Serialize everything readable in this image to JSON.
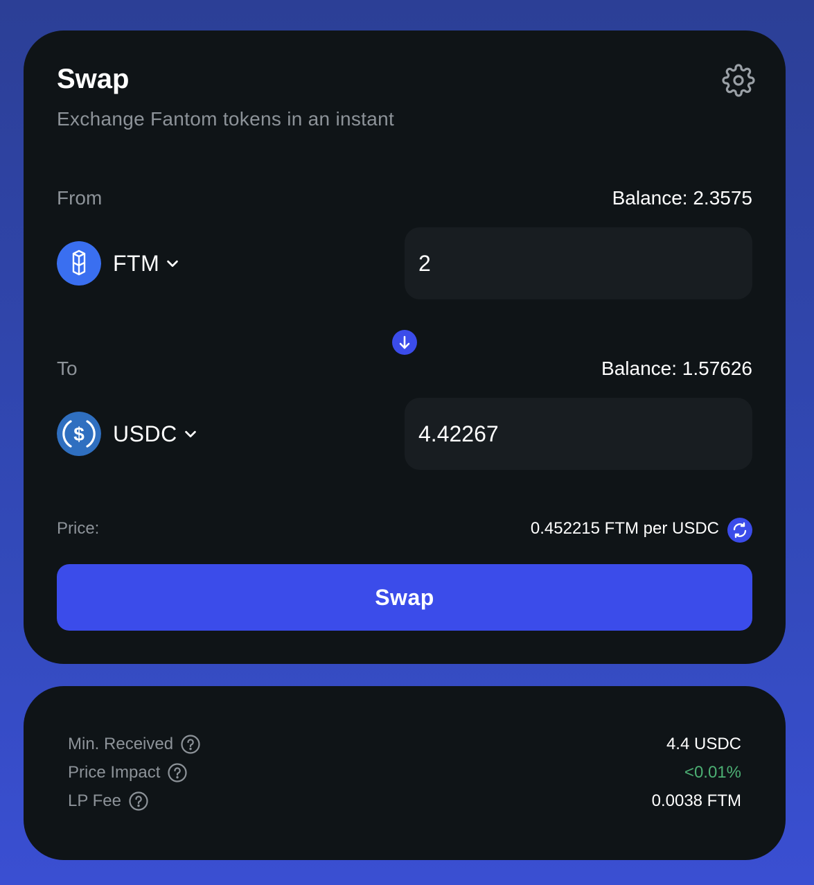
{
  "swap": {
    "title": "Swap",
    "subtitle": "Exchange Fantom tokens in an instant",
    "from": {
      "label": "From",
      "balance": "Balance: 2.3575",
      "token": "FTM",
      "amount": "2"
    },
    "to": {
      "label": "To",
      "balance": "Balance: 1.57626",
      "token": "USDC",
      "amount": "4.42267"
    },
    "price": {
      "label": "Price:",
      "value": "0.452215 FTM per USDC"
    },
    "swap_button_label": "Swap"
  },
  "details": {
    "rows": [
      {
        "label": "Min. Received",
        "value": "4.4 USDC"
      },
      {
        "label": "Price Impact",
        "value": "<0.01%"
      },
      {
        "label": "LP Fee",
        "value": "0.0038 FTM"
      }
    ]
  },
  "colors": {
    "accent": "#3b4cea",
    "card_bg": "#0f1417",
    "input_bg": "#181d21",
    "muted_text": "#8d9399",
    "positive": "#4caf73"
  },
  "icons": {
    "settings": "gear-icon",
    "ftm_token": "fantom-logo-icon",
    "usdc_token": "usdc-logo-icon",
    "dropdown": "chevron-down-icon",
    "flip": "arrow-down-icon",
    "refresh": "refresh-icon",
    "help": "question-circle-icon"
  }
}
